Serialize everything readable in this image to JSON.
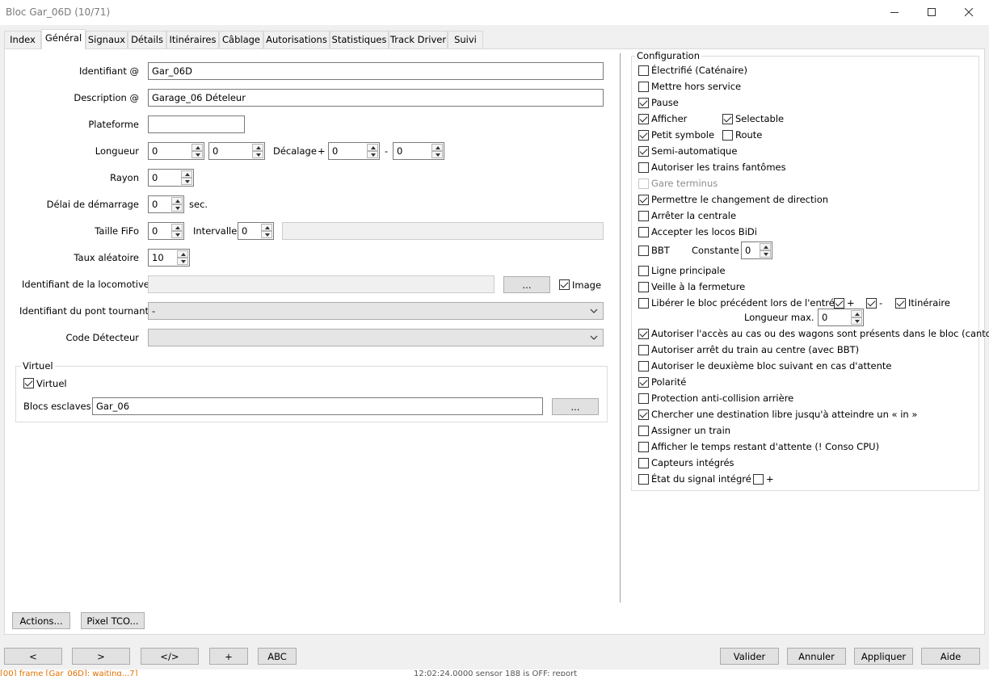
{
  "window": {
    "title": "Bloc Gar_06D (10/71)"
  },
  "tabs": [
    {
      "label": "Index"
    },
    {
      "label": "Général"
    },
    {
      "label": "Signaux"
    },
    {
      "label": "Détails"
    },
    {
      "label": "Itinéraires"
    },
    {
      "label": "Câblage"
    },
    {
      "label": "Autorisations"
    },
    {
      "label": "Statistiques"
    },
    {
      "label": "Track Driver"
    },
    {
      "label": "Suivi"
    }
  ],
  "form": {
    "identifiant": {
      "label": "Identifiant @",
      "value": "Gar_06D"
    },
    "description": {
      "label": "Description @",
      "value": "Garage_06 Dételeur"
    },
    "plateforme": {
      "label": "Plateforme",
      "value": ""
    },
    "longueur": {
      "label": "Longueur",
      "value1": "0",
      "value2": "0"
    },
    "decalage": {
      "label": "Décalage",
      "plus": "+",
      "value1": "0",
      "minus": "-",
      "value2": "0"
    },
    "rayon": {
      "label": "Rayon",
      "value": "0"
    },
    "delai": {
      "label": "Délai de démarrage",
      "value": "0",
      "unit": "sec."
    },
    "fifo": {
      "label": "Taille  FiFo",
      "value": "0"
    },
    "intervalle": {
      "label": "Intervalle",
      "value": "0",
      "extra": ""
    },
    "taux": {
      "label": "Taux aléatoire",
      "value": "10"
    },
    "loco": {
      "label": "Identifiant de la locomotive",
      "value": "",
      "button": "...",
      "image_label": "Image"
    },
    "pont": {
      "label": "Identifiant du pont tournant",
      "value": "-"
    },
    "detecteur": {
      "label": "Code Détecteur",
      "value": ""
    }
  },
  "virtuel": {
    "group_label": "Virtuel",
    "checkbox_label": "Virtuel",
    "blocs_label": "Blocs esclaves",
    "blocs_value": "Gar_06",
    "button": "..."
  },
  "configuration": {
    "title": "Configuration",
    "items": {
      "electrifie": {
        "label": "Électrifié (Caténaire)",
        "checked": false
      },
      "hors_service": {
        "label": "Mettre hors service",
        "checked": false
      },
      "pause": {
        "label": "Pause",
        "checked": true
      },
      "afficher": {
        "label": "Afficher",
        "checked": true
      },
      "selectable": {
        "label": "Selectable",
        "checked": true
      },
      "petit_symbole": {
        "label": "Petit symbole",
        "checked": true
      },
      "route": {
        "label": "Route",
        "checked": false
      },
      "semi_auto": {
        "label": "Semi-automatique",
        "checked": true
      },
      "trains_fantomes": {
        "label": "Autoriser les trains fantômes",
        "checked": false
      },
      "gare_terminus": {
        "label": "Gare terminus",
        "checked": false
      },
      "changement_direction": {
        "label": "Permettre le changement de direction",
        "checked": true
      },
      "arreter_centrale": {
        "label": "Arrêter la centrale",
        "checked": false
      },
      "locos_bidi": {
        "label": "Accepter les locos BiDi",
        "checked": false
      },
      "bbt": {
        "label": "BBT",
        "checked": false
      },
      "constante": {
        "label": "Constante",
        "value": "0"
      },
      "ligne_principale": {
        "label": "Ligne principale",
        "checked": false
      },
      "veille": {
        "label": "Veille à la fermeture",
        "checked": false
      },
      "liberer": {
        "label": "Libérer le bloc précédent lors de l'entrée",
        "checked": false
      },
      "liberer_plus": {
        "label": "+",
        "checked": true
      },
      "liberer_moins": {
        "label": "-",
        "checked": true
      },
      "itineraire": {
        "label": "Itinéraire",
        "checked": true
      },
      "longueur_max": {
        "label": "Longueur max.",
        "value": "0"
      },
      "acces_wagons": {
        "label": "Autoriser l'accès au cas ou des wagons sont présents dans le bloc (canton)",
        "checked": true
      },
      "arret_centre": {
        "label": "Autoriser arrêt du train au centre (avec BBT)",
        "checked": false
      },
      "deuxieme_bloc": {
        "label": "Autoriser le deuxième bloc suivant en cas d'attente",
        "checked": false
      },
      "polarite": {
        "label": "Polarité",
        "checked": true
      },
      "anti_collision": {
        "label": "Protection anti-collision arrière",
        "checked": false
      },
      "destination_libre": {
        "label": "Chercher une destination libre jusqu'à atteindre un « in »",
        "checked": true
      },
      "assigner_train": {
        "label": "Assigner un train",
        "checked": false
      },
      "temps_restant": {
        "label": "Afficher le temps restant d'attente (! Conso CPU)",
        "checked": false
      },
      "capteurs": {
        "label": "Capteurs intégrés",
        "checked": false
      },
      "etat_signal": {
        "label": "État du signal intégré",
        "checked": false
      },
      "etat_signal_plus": {
        "label": "+",
        "checked": false
      }
    }
  },
  "panel_buttons": {
    "actions": "Actions...",
    "pixel_tco": "Pixel TCO..."
  },
  "footer": {
    "prev": "<",
    "next": ">",
    "code": "</>",
    "plus": "+",
    "abc": "ABC",
    "valider": "Valider",
    "annuler": "Annuler",
    "appliquer": "Appliquer",
    "aide": "Aide"
  },
  "status": {
    "left": "[00] frame [Gar_06D]: waiting...7]",
    "right": "12:02:24.0000 sensor 188 is OFF: report"
  }
}
